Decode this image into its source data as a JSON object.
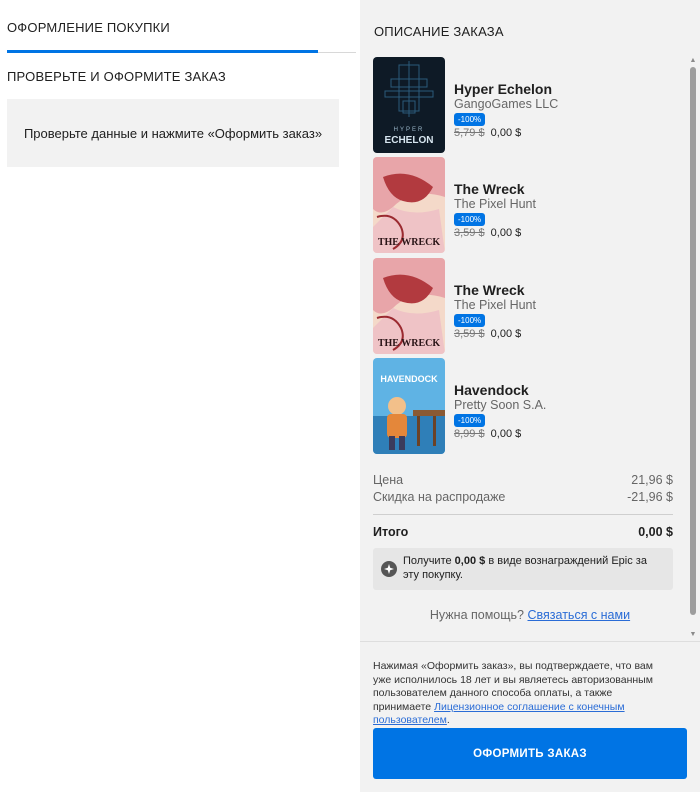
{
  "left": {
    "tab_label": "Оформление покупки",
    "section_title": "Проверьте и оформите заказ",
    "review_text": "Проверьте данные и нажмите «Оформить заказ»"
  },
  "order": {
    "title": "Описание заказа",
    "items": [
      {
        "title": "Hyper Echelon",
        "developer": "GangoGames LLC",
        "discount": "-100%",
        "old_price": "5,79 $",
        "new_price": "0,00 $",
        "art_text": "ECHELON",
        "art_subtext": "HYPER"
      },
      {
        "title": "The Wreck",
        "developer": "The Pixel Hunt",
        "discount": "-100%",
        "old_price": "3,59 $",
        "new_price": "0,00 $",
        "art_text": "THE WRECK"
      },
      {
        "title": "The Wreck",
        "developer": "The Pixel Hunt",
        "discount": "-100%",
        "old_price": "3,59 $",
        "new_price": "0,00 $",
        "art_text": "THE WRECK"
      },
      {
        "title": "Havendock",
        "developer": "Pretty Soon S.A.",
        "discount": "-100%",
        "old_price": "8,99 $",
        "new_price": "0,00 $",
        "art_text": "HAVENDOCK"
      }
    ],
    "summary": {
      "price_label": "Цена",
      "price_value": "21,96 $",
      "sale_label": "Скидка на распродаже",
      "sale_value": "-21,96 $",
      "total_label": "Итого",
      "total_value": "0,00 $"
    },
    "reward": {
      "prefix": "Получите ",
      "amount": "0,00 $",
      "suffix": " в виде вознаграждений Epic за эту покупку."
    },
    "help": {
      "text": "Нужна помощь? ",
      "link": "Связаться с нами"
    }
  },
  "footer": {
    "legal_text": "Нажимая «Оформить заказ», вы подтверждаете, что вам уже исполнилось 18 лет и вы являетесь авторизованным пользователем данного способа оплаты, а также принимаете ",
    "legal_link": "Лицензионное соглашение с конечным пользователем",
    "legal_end": ".",
    "order_button": "Оформить заказ"
  },
  "colors": {
    "accent": "#0074e4",
    "panel_bg": "#f2f2f2",
    "link": "#2a6cd6"
  }
}
